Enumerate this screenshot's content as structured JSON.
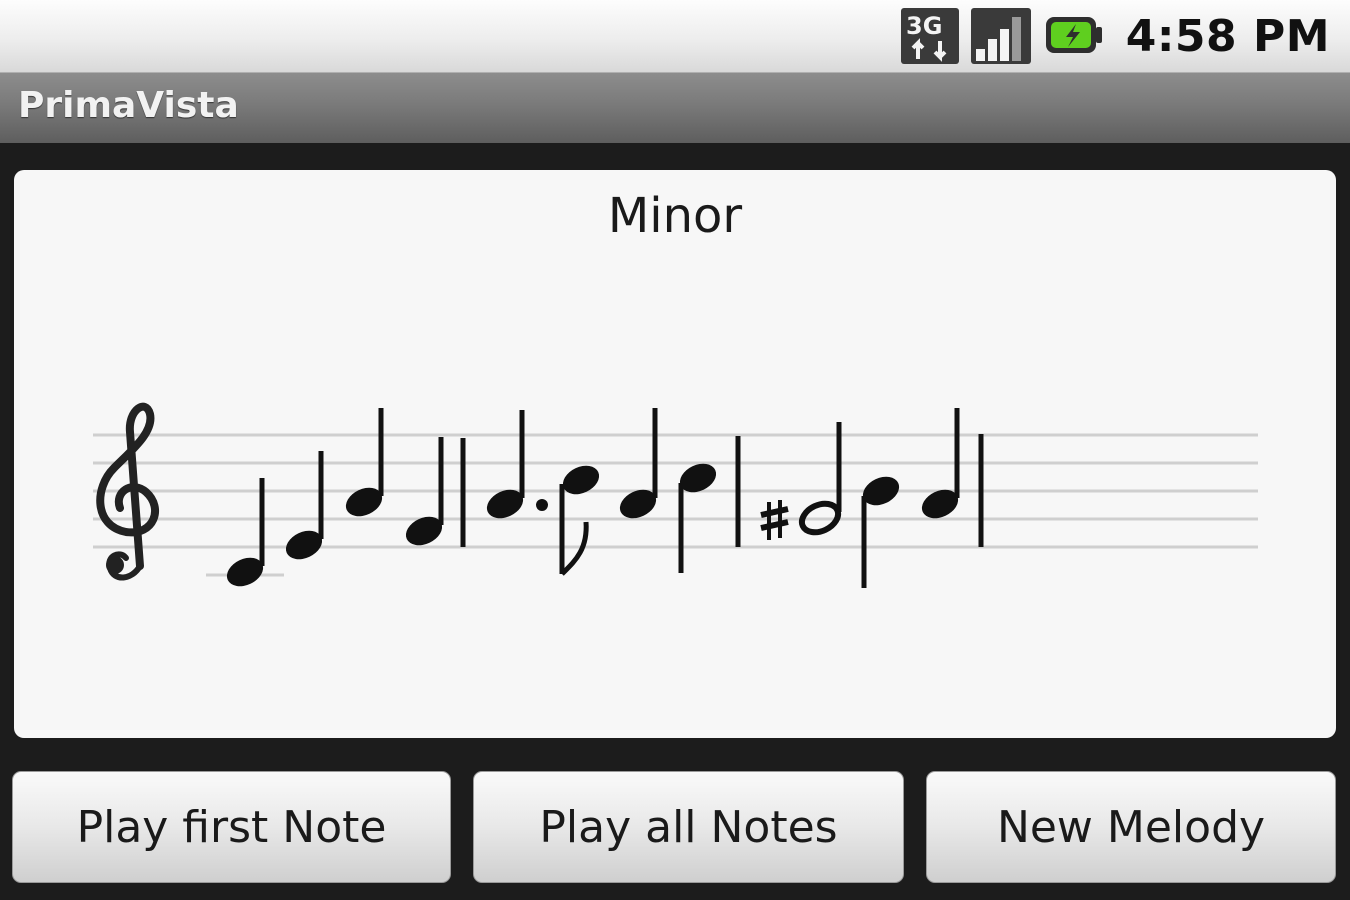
{
  "status_bar": {
    "time": "4:58 PM",
    "icons": [
      "3g-data-icon",
      "signal-strength-icon",
      "battery-charging-icon"
    ],
    "network_label": "3G"
  },
  "app": {
    "title": "PrimaVista"
  },
  "score": {
    "scale_name": "Minor",
    "clef": "treble-clef",
    "accidental": "sharp"
  },
  "buttons": {
    "play_first": "Play first Note",
    "play_all": "Play all Notes",
    "new_melody": "New Melody"
  },
  "colors": {
    "panel_bg": "#f7f7f7",
    "staff_line": "#cfcfcf",
    "battery_green": "#4caf1a",
    "title_text": "#f2f2f2"
  }
}
